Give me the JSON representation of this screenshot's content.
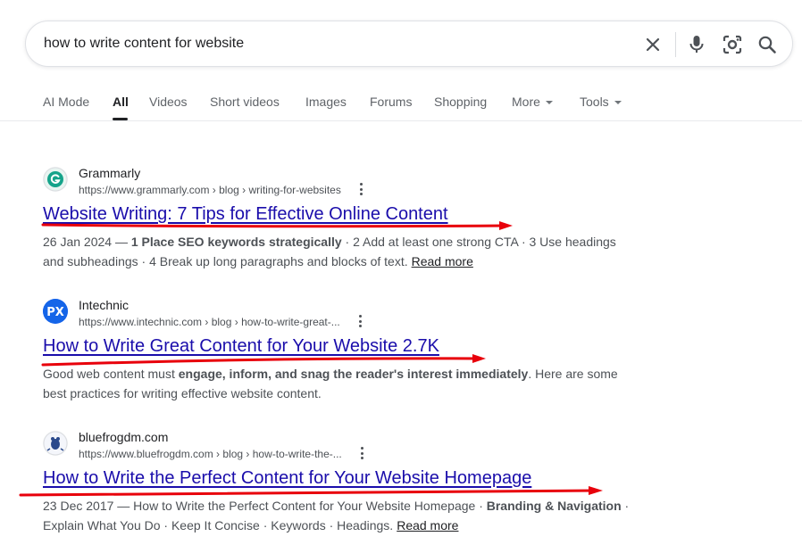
{
  "search": {
    "query": "how to write content for website"
  },
  "tabs": [
    {
      "label": "AI Mode"
    },
    {
      "label": "All"
    },
    {
      "label": "Videos"
    },
    {
      "label": "Short videos"
    },
    {
      "label": "Images"
    },
    {
      "label": "Forums"
    },
    {
      "label": "Shopping"
    },
    {
      "label": "More"
    },
    {
      "label": "Tools"
    }
  ],
  "active_tab": "All",
  "icons": {
    "clear": "close-icon",
    "voice": "microphone-icon",
    "lens": "camera-lens-icon",
    "search": "search-icon",
    "kebab": "more-vert-icon"
  },
  "colors": {
    "link": "#1a0dab",
    "annotation": "#e8000b"
  },
  "results": [
    {
      "site_name": "Grammarly",
      "url": "https://www.grammarly.com › blog › writing-for-websites",
      "title": "Website Writing: 7 Tips for Effective Online Content",
      "snippet": {
        "date": "26 Jan 2024 — ",
        "bold1": "1 Place SEO keywords strategically",
        "rest": " · 2 Add at least one strong CTA · 3 Use headings and subheadings · 4 Break up long paragraphs and blocks of text.",
        "read_more": "Read more"
      }
    },
    {
      "site_name": "Intechnic",
      "url": "https://www.intechnic.com › blog › how-to-write-great-...",
      "title": "How to Write Great Content for Your Website 2.7K",
      "snippet": {
        "pre": "Good web content must ",
        "bold1": "engage, inform, and snag the reader's interest immediately",
        "rest": ". Here are some best practices for writing effective website content."
      }
    },
    {
      "site_name": "bluefrogdm.com",
      "url": "https://www.bluefrogdm.com › blog › how-to-write-the-...",
      "title": "How to Write the Perfect Content for Your Website Homepage",
      "snippet": {
        "date": "23 Dec 2017 — ",
        "pre": "How to Write the Perfect Content for Your Website Homepage · ",
        "bold1": "Branding & Navigation",
        "rest": " · Explain What You Do · Keep It Concise · Keywords · Headings.",
        "read_more": "Read more"
      }
    }
  ]
}
